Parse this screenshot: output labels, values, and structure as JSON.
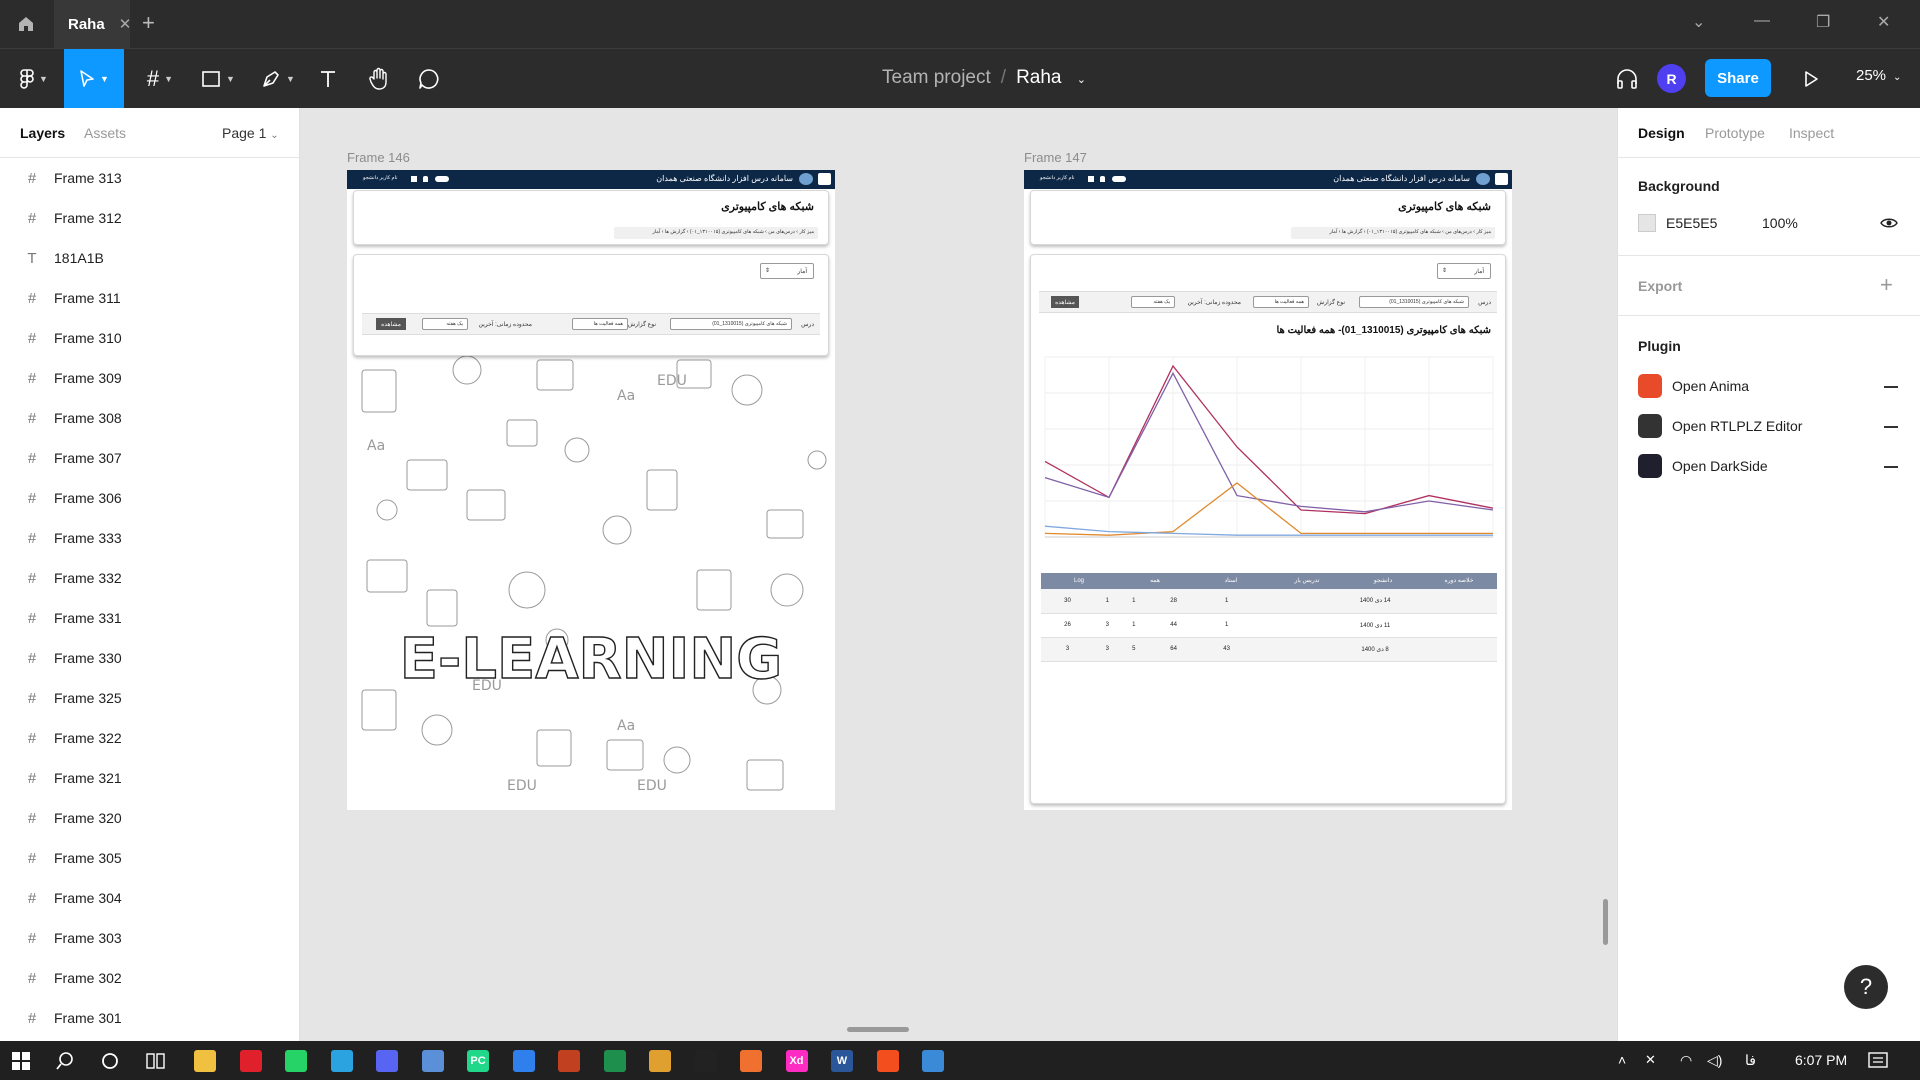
{
  "app": {
    "tab_label": "Raha",
    "breadcrumb": {
      "project": "Team project",
      "separator": "/",
      "file": "Raha"
    },
    "avatar_initial": "R",
    "share_label": "Share",
    "zoom": "25%"
  },
  "left_panel": {
    "tabs": [
      "Layers",
      "Assets"
    ],
    "page_select": "Page 1",
    "layers": [
      {
        "name": "Frame 313",
        "icon": "frame-icon"
      },
      {
        "name": "Frame 312",
        "icon": "frame-icon"
      },
      {
        "name": "181A1B",
        "icon": "text-icon"
      },
      {
        "name": "Frame 311",
        "icon": "frame-icon"
      },
      {
        "name": "Frame 310",
        "icon": "frame-icon"
      },
      {
        "name": "Frame 309",
        "icon": "frame-icon"
      },
      {
        "name": "Frame 308",
        "icon": "frame-icon"
      },
      {
        "name": "Frame 307",
        "icon": "frame-icon"
      },
      {
        "name": "Frame 306",
        "icon": "frame-icon"
      },
      {
        "name": "Frame 333",
        "icon": "frame-icon"
      },
      {
        "name": "Frame 332",
        "icon": "frame-icon"
      },
      {
        "name": "Frame 331",
        "icon": "frame-icon"
      },
      {
        "name": "Frame 330",
        "icon": "frame-icon"
      },
      {
        "name": "Frame 325",
        "icon": "frame-icon"
      },
      {
        "name": "Frame 322",
        "icon": "frame-icon"
      },
      {
        "name": "Frame 321",
        "icon": "frame-icon"
      },
      {
        "name": "Frame 320",
        "icon": "frame-icon"
      },
      {
        "name": "Frame 305",
        "icon": "frame-icon"
      },
      {
        "name": "Frame 304",
        "icon": "frame-icon"
      },
      {
        "name": "Frame 303",
        "icon": "frame-icon"
      },
      {
        "name": "Frame 302",
        "icon": "frame-icon"
      },
      {
        "name": "Frame 301",
        "icon": "frame-icon"
      }
    ]
  },
  "canvas": {
    "frame_146": {
      "label": "Frame 146",
      "site_title": "سامانه درس افزار دانشگاه صنعتی همدان",
      "user_text": "نام کاربر دانشجو",
      "course_title": "شبکه های کامپیوتری",
      "breadcrumb": "میز کار › درس‌های من › شبکه های کامپیوتری (۱۳۱۰۰۱۵_۰۱) › گزارش ها › آمار",
      "stat_select": "آمار",
      "filter_course_label": "درس",
      "filter_course_value": "شبکه های کامپیوتری (1310015_01)",
      "filter_type_label": "نوع گزارش",
      "filter_type_value": "همه فعالیت ها",
      "filter_range_label": "محدوده زمانی: آخرین",
      "filter_range_value": "یک هفته",
      "view_button": "مشاهده",
      "watermark": "E-LEARNING",
      "doodle_words": [
        "Aa",
        "EDU",
        "EDU",
        "Aa",
        "EDU",
        "Aa",
        "EDU"
      ]
    },
    "frame_147": {
      "label": "Frame 147",
      "site_title": "سامانه درس افزار دانشگاه صنعتی همدان",
      "user_text": "نام کاربر دانشجو",
      "course_title": "شبکه های کامپیوتری",
      "breadcrumb": "میز کار › درس‌های من › شبکه های کامپیوتری (۱۳۱۰۰۱۵_۰۱) › گزارش ها › آمار",
      "stat_select": "آمار",
      "filter_course_label": "درس",
      "filter_course_value": "شبکه های کامپیوتری (1310015_01)",
      "filter_type_label": "نوع گزارش",
      "filter_type_value": "همه فعالیت ها",
      "filter_range_label": "محدوده زمانی: آخرین",
      "filter_range_value": "یک هفته",
      "view_button": "مشاهده",
      "report_title": "شبکه های کامپیوتری (1310015_01)- همه فعالیت ها",
      "table": {
        "headers": [
          "خلاصه دوره",
          "دانشجو",
          "تدریس یار",
          "استاد",
          "همه",
          "Log"
        ],
        "rows": [
          [
            "14 دی 1400",
            "1",
            "28",
            "1",
            "1",
            "30"
          ],
          [
            "11 دی 1400",
            "1",
            "44",
            "1",
            "3",
            "26"
          ],
          [
            "8 دی 1400",
            "43",
            "64",
            "5",
            "3",
            "3"
          ]
        ],
        "header_color": "#7d8aa3"
      }
    }
  },
  "chart_data": {
    "type": "line",
    "x": [
      1,
      2,
      3,
      4,
      5,
      6,
      7,
      8
    ],
    "ylim": [
      0,
      100
    ],
    "series": [
      {
        "values": [
          42,
          22,
          95,
          50,
          15,
          13,
          23,
          16
        ],
        "color": "#b03060"
      },
      {
        "values": [
          33,
          22,
          91,
          23,
          17,
          14,
          20,
          15
        ],
        "color": "#8060a8"
      },
      {
        "values": [
          2,
          1,
          3,
          30,
          2,
          2,
          2,
          2
        ],
        "color": "#e08a30"
      },
      {
        "values": [
          6,
          3,
          2,
          1,
          1,
          1,
          1,
          1
        ],
        "color": "#80a8e0"
      }
    ]
  },
  "right_panel": {
    "tabs": [
      "Design",
      "Prototype",
      "Inspect"
    ],
    "background_title": "Background",
    "background_hex": "E5E5E5",
    "background_opacity": "100%",
    "background_swatch": "#e5e5e5",
    "export_title": "Export",
    "plugin_title": "Plugin",
    "plugins": [
      {
        "name": "Open Anima",
        "icon": "anima-icon",
        "color": "#e84b2a"
      },
      {
        "name": "Open RTLPLZ Editor",
        "icon": "rtl-icon",
        "color": "#333333"
      },
      {
        "name": "Open DarkSide",
        "icon": "darkside-icon",
        "color": "#1f1f2e"
      }
    ]
  },
  "help_label": "?",
  "taskbar": {
    "apps": [
      {
        "icon": "file-explorer-icon",
        "color": "#f0c040"
      },
      {
        "icon": "opera-icon",
        "color": "#e0202a"
      },
      {
        "icon": "whatsapp-icon",
        "color": "#25d366"
      },
      {
        "icon": "telegram-icon",
        "color": "#2aa3e0"
      },
      {
        "icon": "discord-icon",
        "color": "#5865f2"
      },
      {
        "icon": "cube-icon",
        "color": "#5b8fd8"
      },
      {
        "icon": "pycharm-icon",
        "color": "#21d789",
        "label": "PC"
      },
      {
        "icon": "vscode-icon",
        "color": "#2f80ed"
      },
      {
        "icon": "matlab-icon",
        "color": "#c04020"
      },
      {
        "icon": "excel-icon",
        "color": "#1f8f4e"
      },
      {
        "icon": "app-icon",
        "color": "#e0a030"
      },
      {
        "icon": "webstorm-icon",
        "color": "#222222"
      },
      {
        "icon": "xampp-icon",
        "color": "#f07030"
      },
      {
        "icon": "xd-icon",
        "color": "#ff2bc2",
        "label": "Xd"
      },
      {
        "icon": "word-icon",
        "color": "#2b579a",
        "label": "W"
      },
      {
        "icon": "figma-icon",
        "color": "#f24e1e"
      },
      {
        "icon": "photos-icon",
        "color": "#3a8ad8"
      }
    ],
    "lang": "فا",
    "time": "6:07 PM"
  }
}
